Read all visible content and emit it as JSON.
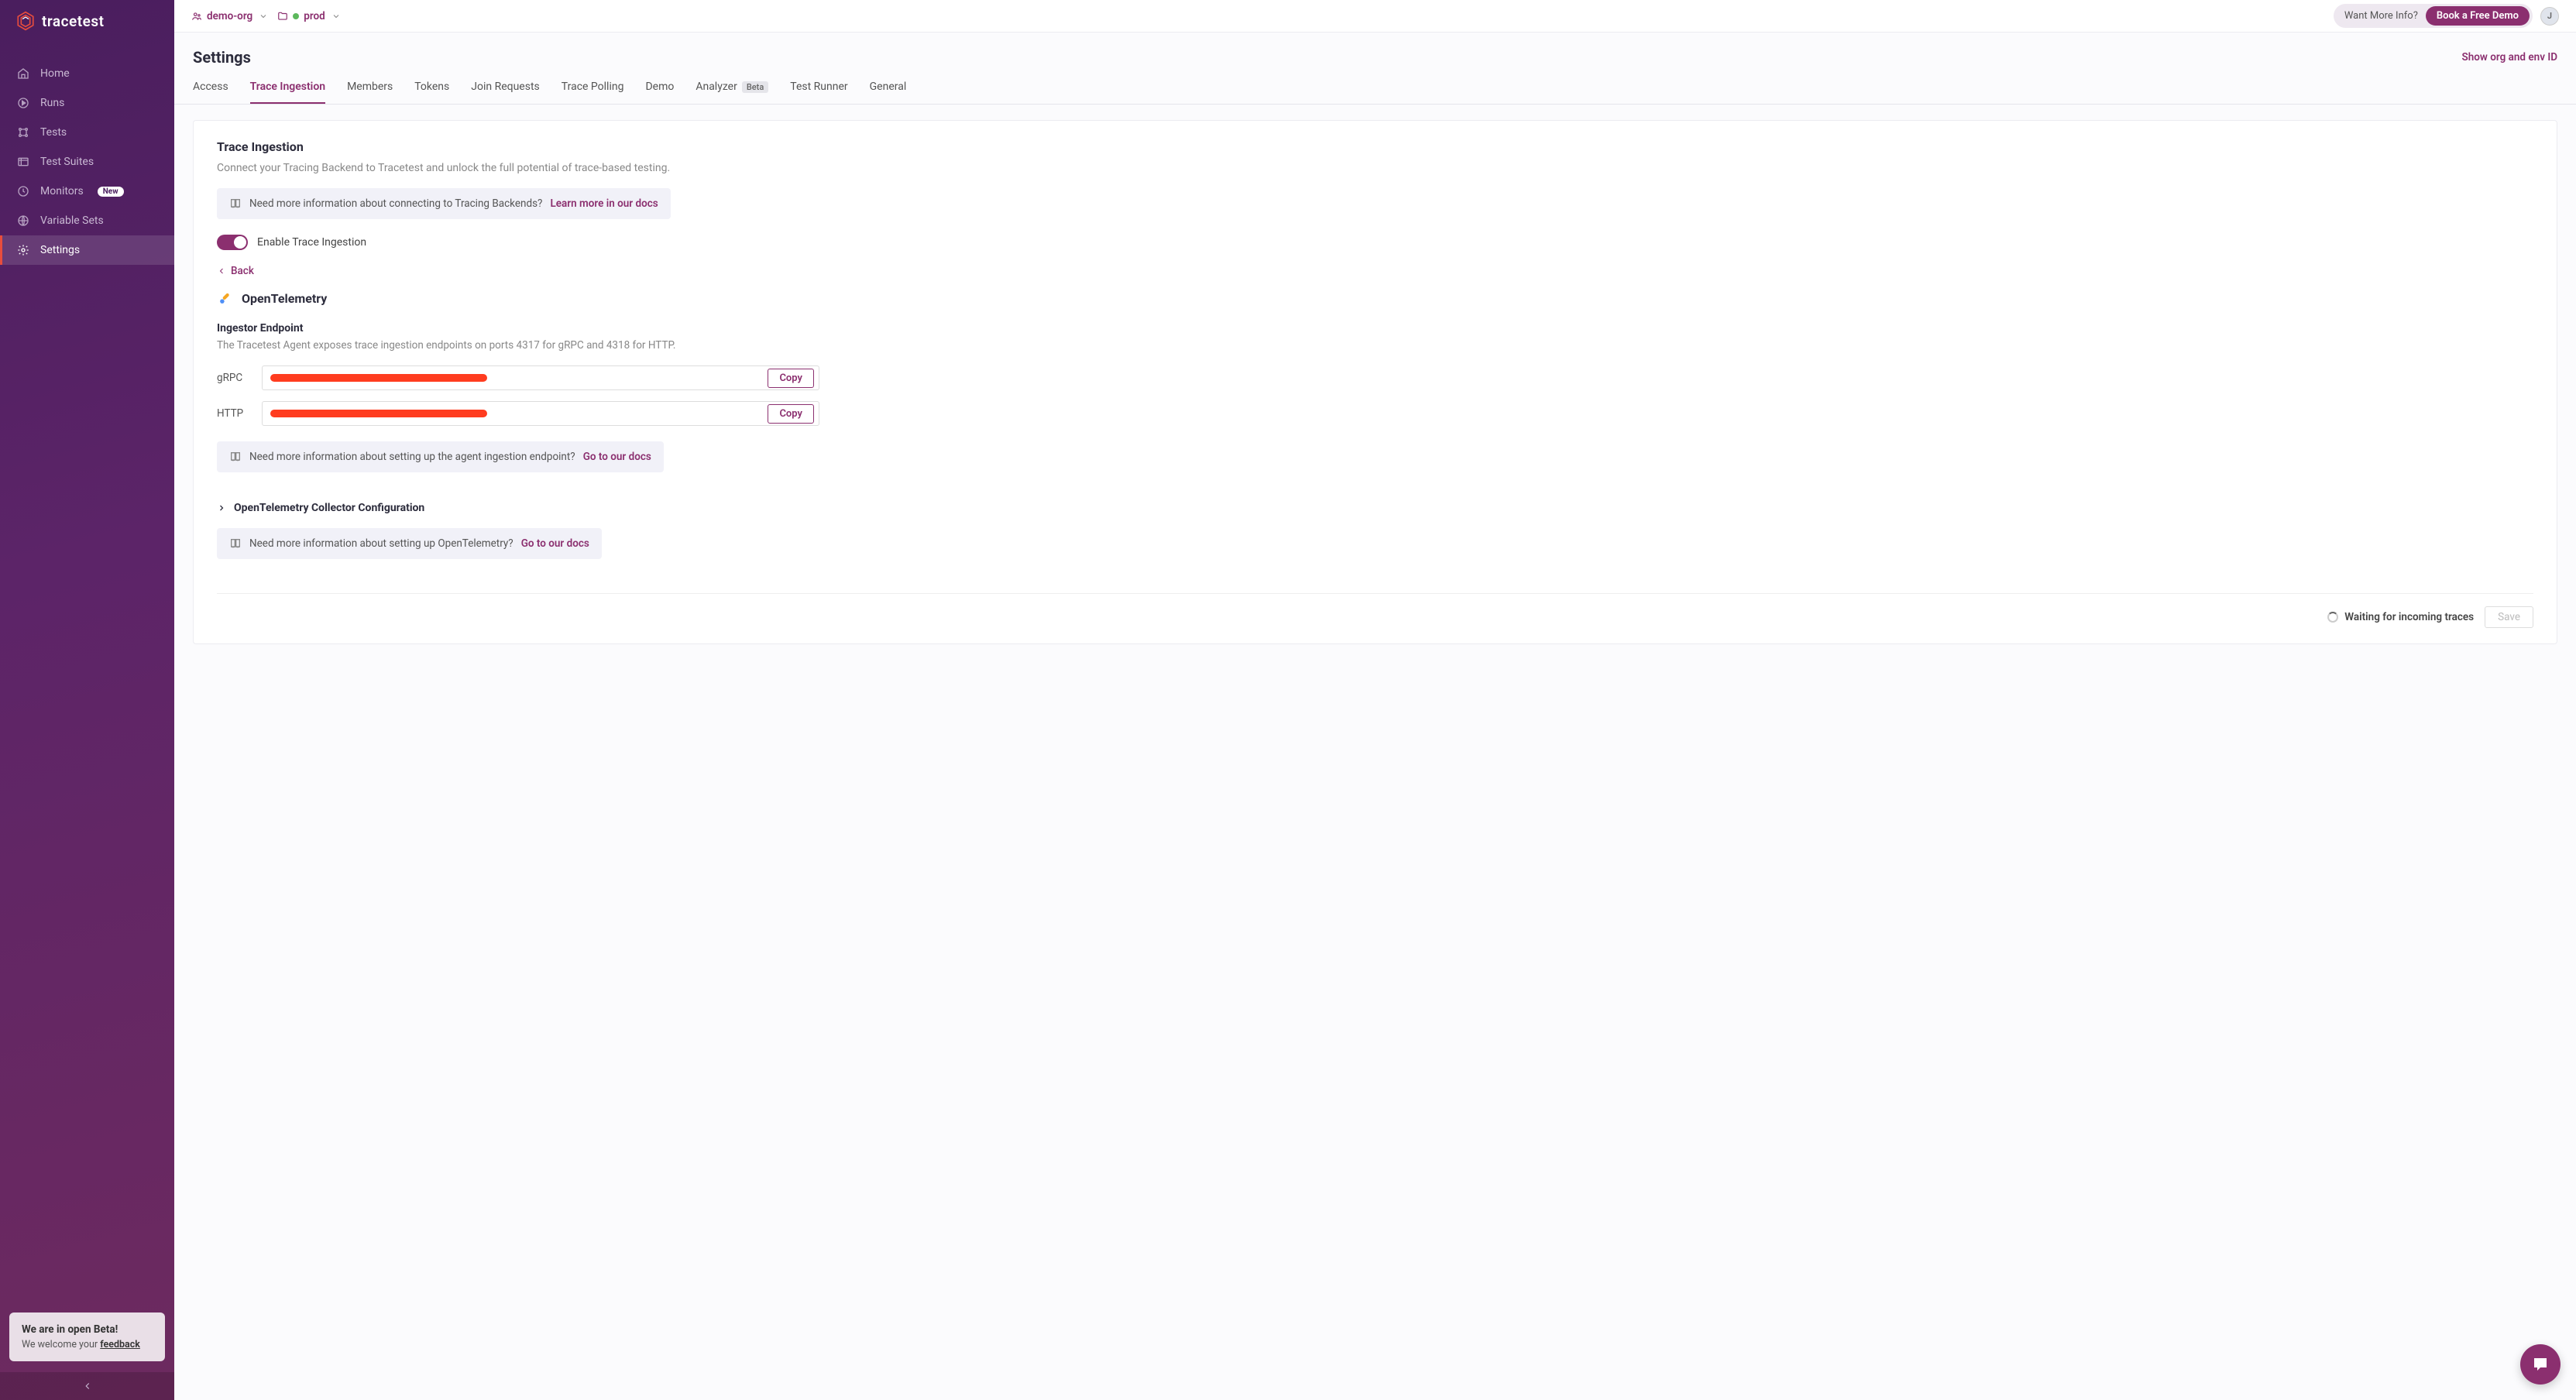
{
  "brand": "tracetest",
  "breadcrumb": {
    "org": "demo-org",
    "env": "prod"
  },
  "topbar": {
    "info_text": "Want More Info?",
    "book_demo": "Book a Free Demo",
    "avatar_initial": "J"
  },
  "sidebar": {
    "items": [
      {
        "label": "Home"
      },
      {
        "label": "Runs"
      },
      {
        "label": "Tests"
      },
      {
        "label": "Test Suites"
      },
      {
        "label": "Monitors",
        "badge": "New"
      },
      {
        "label": "Variable Sets"
      },
      {
        "label": "Settings"
      }
    ],
    "beta": {
      "title": "We are in open Beta!",
      "subtitle_prefix": "We welcome your ",
      "subtitle_link": "feedback"
    }
  },
  "page": {
    "title": "Settings",
    "show_ids": "Show org and env ID"
  },
  "tabs": [
    {
      "label": "Access"
    },
    {
      "label": "Trace Ingestion"
    },
    {
      "label": "Members"
    },
    {
      "label": "Tokens"
    },
    {
      "label": "Join Requests"
    },
    {
      "label": "Trace Polling"
    },
    {
      "label": "Demo"
    },
    {
      "label": "Analyzer",
      "badge": "Beta"
    },
    {
      "label": "Test Runner"
    },
    {
      "label": "General"
    }
  ],
  "section": {
    "title": "Trace Ingestion",
    "description": "Connect your Tracing Backend to Tracetest and unlock the full potential of trace-based testing.",
    "info_prefix": "Need more information about connecting to Tracing Backends? ",
    "info_link": "Learn more in our docs",
    "toggle_label": "Enable Trace Ingestion",
    "back": "Back",
    "ot_title": "OpenTelemetry",
    "ingestor": {
      "title": "Ingestor Endpoint",
      "description": "The Tracetest Agent exposes trace ingestion endpoints on ports 4317 for gRPC and 4318 for HTTP.",
      "grpc_label": "gRPC",
      "http_label": "HTTP",
      "copy": "Copy"
    },
    "agent_info_prefix": "Need more information about setting up the agent ingestion endpoint? ",
    "agent_info_link": "Go to our docs",
    "collector_config": "OpenTelemetry Collector Configuration",
    "ot_info_prefix": "Need more information about setting up OpenTelemetry? ",
    "ot_info_link": "Go to our docs"
  },
  "footer": {
    "waiting": "Waiting for incoming traces",
    "save": "Save"
  }
}
